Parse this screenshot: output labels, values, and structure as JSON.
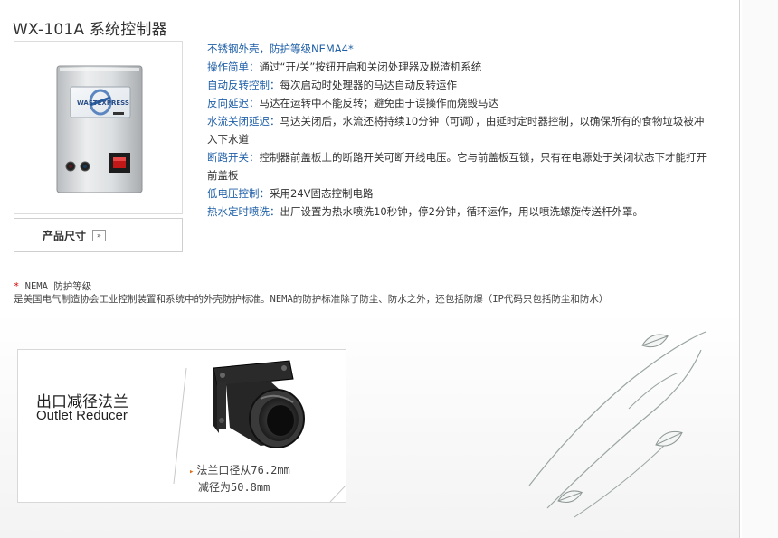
{
  "page": {
    "title": "WX-101A 系统控制器"
  },
  "product": {
    "panel_brand": "WASTEXPRESS",
    "size_button_label": "产品尺寸",
    "size_button_arrow": "»"
  },
  "features": [
    {
      "key": "不锈钢外壳，防护等级NEMA4*",
      "text": ""
    },
    {
      "key": "操作简单：",
      "text": "通过“开/关”按钮开启和关闭处理器及脱渣机系统"
    },
    {
      "key": "自动反转控制：",
      "text": "每次启动时处理器的马达自动反转运作"
    },
    {
      "key": "反向延迟：",
      "text": "马达在运转中不能反转；避免由于误操作而烧毁马达"
    },
    {
      "key": "水流关闭延迟：",
      "text": "马达关闭后，水流还将持续10分钟（可调），由延时定时器控制，以确保所有的食物垃圾被冲入下水道"
    },
    {
      "key": "断路开关：",
      "text": "控制器前盖板上的断路开关可断开线电压。它与前盖板互锁，只有在电源处于关闭状态下才能打开前盖板"
    },
    {
      "key": "低电压控制：",
      "text": "采用24V固态控制电路"
    },
    {
      "key": "热水定时喷洗：",
      "text": "出厂设置为热水喷洗10秒钟，停2分钟，循环运作，用以喷洗螺旋传送杆外罩。"
    }
  ],
  "nema": {
    "star": "*",
    "heading": "NEMA 防护等级",
    "description": "是美国电气制造协会工业控制装置和系统中的外壳防护标准。NEMA的防护标准除了防尘、防水之外，还包括防爆（IP代码只包括防尘和防水）"
  },
  "outlet": {
    "title_cn": "出口减径法兰",
    "title_en": "Outlet Reducer",
    "spec_line1": "法兰口径从76.2mm",
    "spec_line2": "减径为50.8mm"
  },
  "colors": {
    "feature_key": "#1f5fa8",
    "accent_star": "#d60000",
    "bullet": "#e07020"
  }
}
